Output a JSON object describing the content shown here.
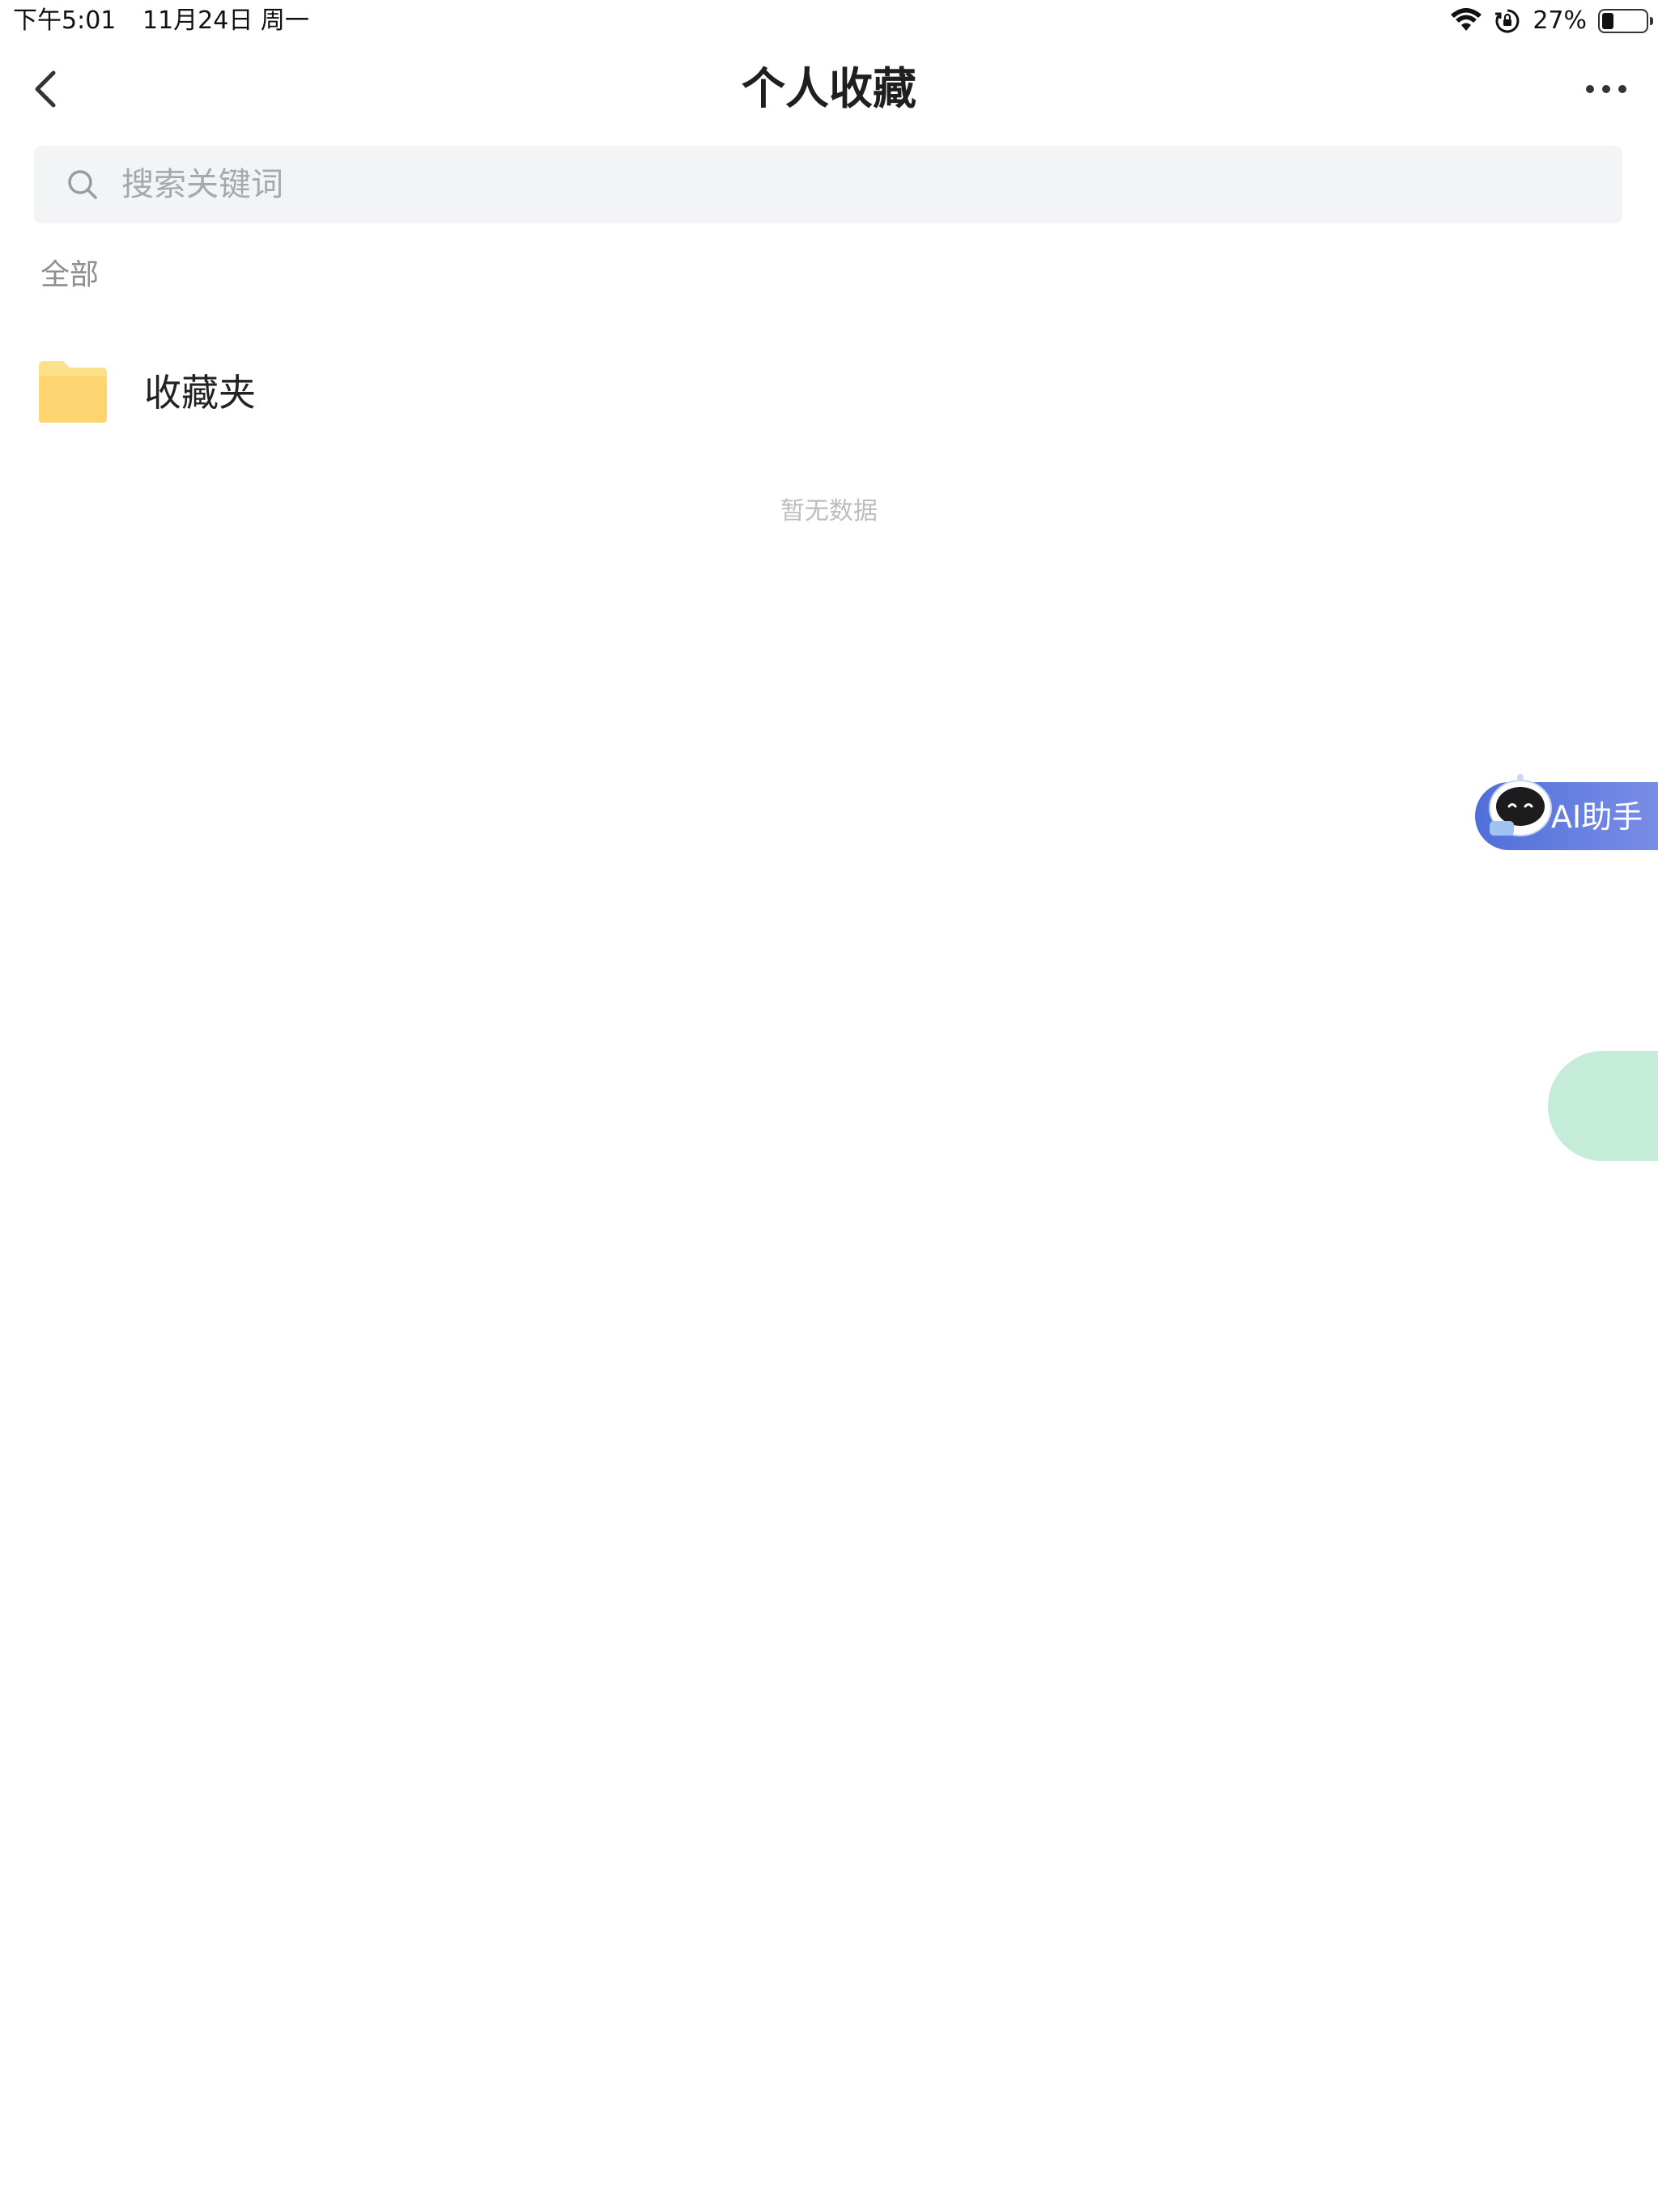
{
  "status_bar": {
    "time": "下午5:01",
    "date": "11月24日 周一",
    "battery_percent": "27%",
    "battery_level": 0.27,
    "icons": [
      "wifi-icon",
      "orientation-lock-icon",
      "battery-icon"
    ]
  },
  "nav": {
    "title": "个人收藏",
    "back_icon": "chevron-left-icon",
    "more_icon": "more-horizontal-icon"
  },
  "search": {
    "placeholder": "搜索关键词",
    "value": "",
    "icon": "search-icon"
  },
  "content": {
    "section_label": "全部",
    "folders": [
      {
        "name": "收藏夹",
        "icon": "folder-icon"
      }
    ],
    "empty_text": "暂无数据"
  },
  "floating": {
    "ai_assistant_label": "AI助手",
    "ai_avatar_icon": "robot-avatar-icon"
  },
  "colors": {
    "folder": "#fdd46f",
    "search_bg": "#f3f4f6",
    "ai_gradient_start": "#4f6fd8",
    "ai_gradient_end": "#7a8de6",
    "float_ball": "#c5ecd8"
  }
}
